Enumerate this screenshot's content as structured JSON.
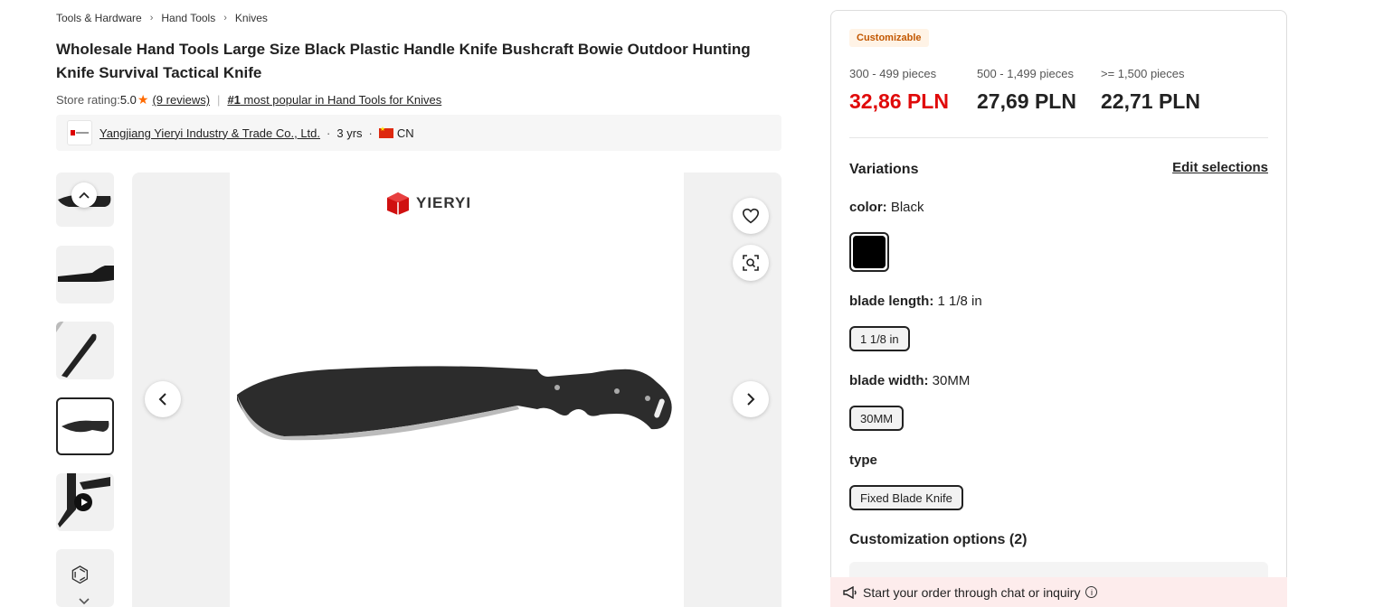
{
  "breadcrumb": [
    "Tools & Hardware",
    "Hand Tools",
    "Knives"
  ],
  "product": {
    "title": "Wholesale Hand Tools Large Size Black Plastic Handle Knife Bushcraft Bowie Outdoor Hunting Knife Survival Tactical Knife",
    "rating_label": "Store rating:",
    "rating_value": "5.0",
    "reviews": "(9 reviews)",
    "popular_rank": "#1",
    "popular_text": " most popular in Hand Tools for Knives"
  },
  "supplier": {
    "name": "Yangjiang Yieryi Industry & Trade Co., Ltd.",
    "years": "3 yrs",
    "country": "CN"
  },
  "image": {
    "brand": "YIERYI"
  },
  "pricing": {
    "badge": "Customizable",
    "tiers": [
      {
        "qty": "300 - 499 pieces",
        "price": "32,86 PLN",
        "color": "#e00a0a"
      },
      {
        "qty": "500 - 1,499 pieces",
        "price": "27,69 PLN",
        "color": "#222222"
      },
      {
        "qty": ">= 1,500 pieces",
        "price": "22,71 PLN",
        "color": "#222222"
      }
    ]
  },
  "variations": {
    "title": "Variations",
    "edit": "Edit selections",
    "color_label": "color:",
    "color_value": " Black",
    "blade_length_label": "blade length:",
    "blade_length_value": " 1 1/8 in",
    "blade_length_chip": "1 1/8 in",
    "blade_width_label": "blade width:",
    "blade_width_value": " 30MM",
    "blade_width_chip": "30MM",
    "type_label": "type",
    "type_chip": "Fixed Blade Knife"
  },
  "customization": {
    "title": "Customization options (2)"
  },
  "chat_bar": {
    "text": "Start your order through chat or inquiry"
  }
}
